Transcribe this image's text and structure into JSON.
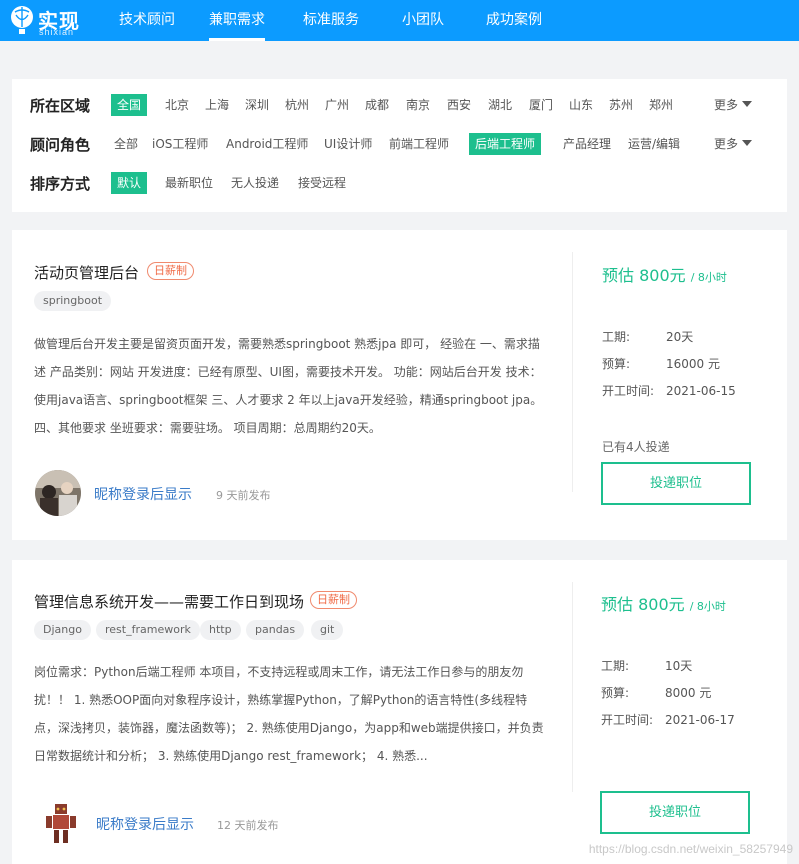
{
  "header": {
    "logo_text": "实现",
    "logo_sub": "shixian",
    "nav": [
      "技术顾问",
      "兼职需求",
      "标准服务",
      "小团队",
      "成功案例"
    ],
    "active_nav": "兼职需求",
    "colors": {
      "brand": "#0c9bff",
      "accent": "#1dbf8e",
      "badge": "#f06b47"
    }
  },
  "filters": {
    "region": {
      "label": "所在区域",
      "options": [
        "全国",
        "北京",
        "上海",
        "深圳",
        "杭州",
        "广州",
        "成都",
        "南京",
        "西安",
        "湖北",
        "厦门",
        "山东",
        "苏州",
        "郑州"
      ],
      "selected": "全国",
      "more": "更多"
    },
    "role": {
      "label": "顾问角色",
      "options": [
        "全部",
        "iOS工程师",
        "Android工程师",
        "UI设计师",
        "前端工程师",
        "后端工程师",
        "产品经理",
        "运营/编辑"
      ],
      "selected": "后端工程师",
      "more": "更多"
    },
    "sort": {
      "label": "排序方式",
      "options": [
        "默认",
        "最新职位",
        "无人投递",
        "接受远程"
      ],
      "selected": "默认"
    }
  },
  "jobs": [
    {
      "title": "活动页管理后台",
      "badge": "日薪制",
      "tags": [
        "springboot"
      ],
      "description": "做管理后台开发主要是留资页面开发，需要熟悉springboot 熟悉jpa 即可， 经验在 一、需求描述 产品类别：网站 开发进度：已经有原型、UI图，需要技术开发。 功能：网站后台开发 技术：使用java语言、springboot框架 三、人才要求 2 年以上java开发经验，精通springboot jpa。 四、其他要求 坐班要求：需要驻场。 项目周期：总周期约20天。",
      "nickname": "昵称登录后显示",
      "posted": "9 天前发布",
      "estimate_label": "预估 800元",
      "estimate_unit": "/ 8小时",
      "period_label": "工期:",
      "period": "20天",
      "budget_label": "预算:",
      "budget": "16000 元",
      "start_label": "开工时间:",
      "start": "2021-06-15",
      "applied": "已有4人投递",
      "apply_button": "投递职位"
    },
    {
      "title": "管理信息系统开发——需要工作日到现场",
      "badge": "日薪制",
      "tags": [
        "Django",
        "rest_framework",
        "http",
        "pandas",
        "git"
      ],
      "description": "岗位需求：Python后端工程师 本项目，不支持远程或周末工作，请无法工作日参与的朋友勿扰！！ 1. 熟悉OOP面向对象程序设计，熟练掌握Python，了解Python的语言特性(多线程特点，深浅拷贝，装饰器，魔法函数等)； 2. 熟练使用Django，为app和web端提供接口，并负责日常数据统计和分析； 3. 熟练使用Django rest_framework； 4. 熟悉...",
      "nickname": "昵称登录后显示",
      "posted": "12 天前发布",
      "estimate_label": "预估 800元",
      "estimate_unit": "/ 8小时",
      "period_label": "工期:",
      "period": "10天",
      "budget_label": "预算:",
      "budget": "8000 元",
      "start_label": "开工时间:",
      "start": "2021-06-17",
      "applied": "",
      "apply_button": "投递职位"
    }
  ],
  "watermark": "https://blog.csdn.net/weixin_58257949"
}
